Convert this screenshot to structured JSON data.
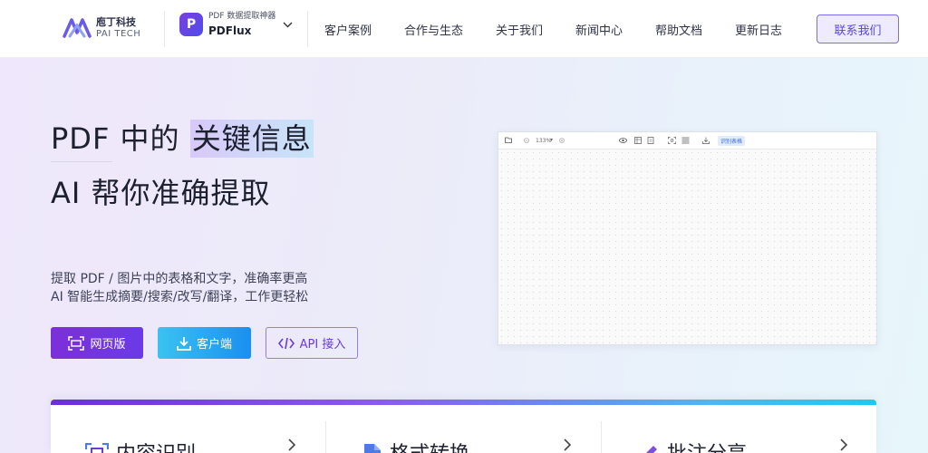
{
  "brand": {
    "name_cn": "庖丁科技",
    "name_en": "PAI TECH",
    "color": "#6a5ae8"
  },
  "product": {
    "subtitle": "PDF 数据提取神器",
    "name": "PDFlux",
    "icon_letter": "P"
  },
  "nav": {
    "items": [
      "客户案例",
      "合作与生态",
      "关于我们",
      "新闻中心",
      "帮助文档",
      "更新日志"
    ],
    "contact": "联系我们"
  },
  "hero": {
    "title_prefix": "PDF 中的 ",
    "title_highlight": "关键信息",
    "title_line2": "AI 帮你准确提取",
    "desc_line1": "提取 PDF / 图片中的表格和文字，准确率更高",
    "desc_line2": "AI 智能生成摘要/搜索/改写/翻译，工作更轻松",
    "btn_web": "网页版",
    "btn_client": "客户端",
    "btn_api": "API 接入"
  },
  "preview": {
    "zoom": "133%",
    "badge": "识别表格"
  },
  "features": [
    {
      "title": "内容识别",
      "icon": "scan-icon"
    },
    {
      "title": "格式转换",
      "icon": "file-icon"
    },
    {
      "title": "批注分享",
      "icon": "pen-icon"
    }
  ],
  "colors": {
    "primary": "#7c2fd9",
    "secondary": "#1a8ff0",
    "accent_border": "#9a7be0"
  }
}
